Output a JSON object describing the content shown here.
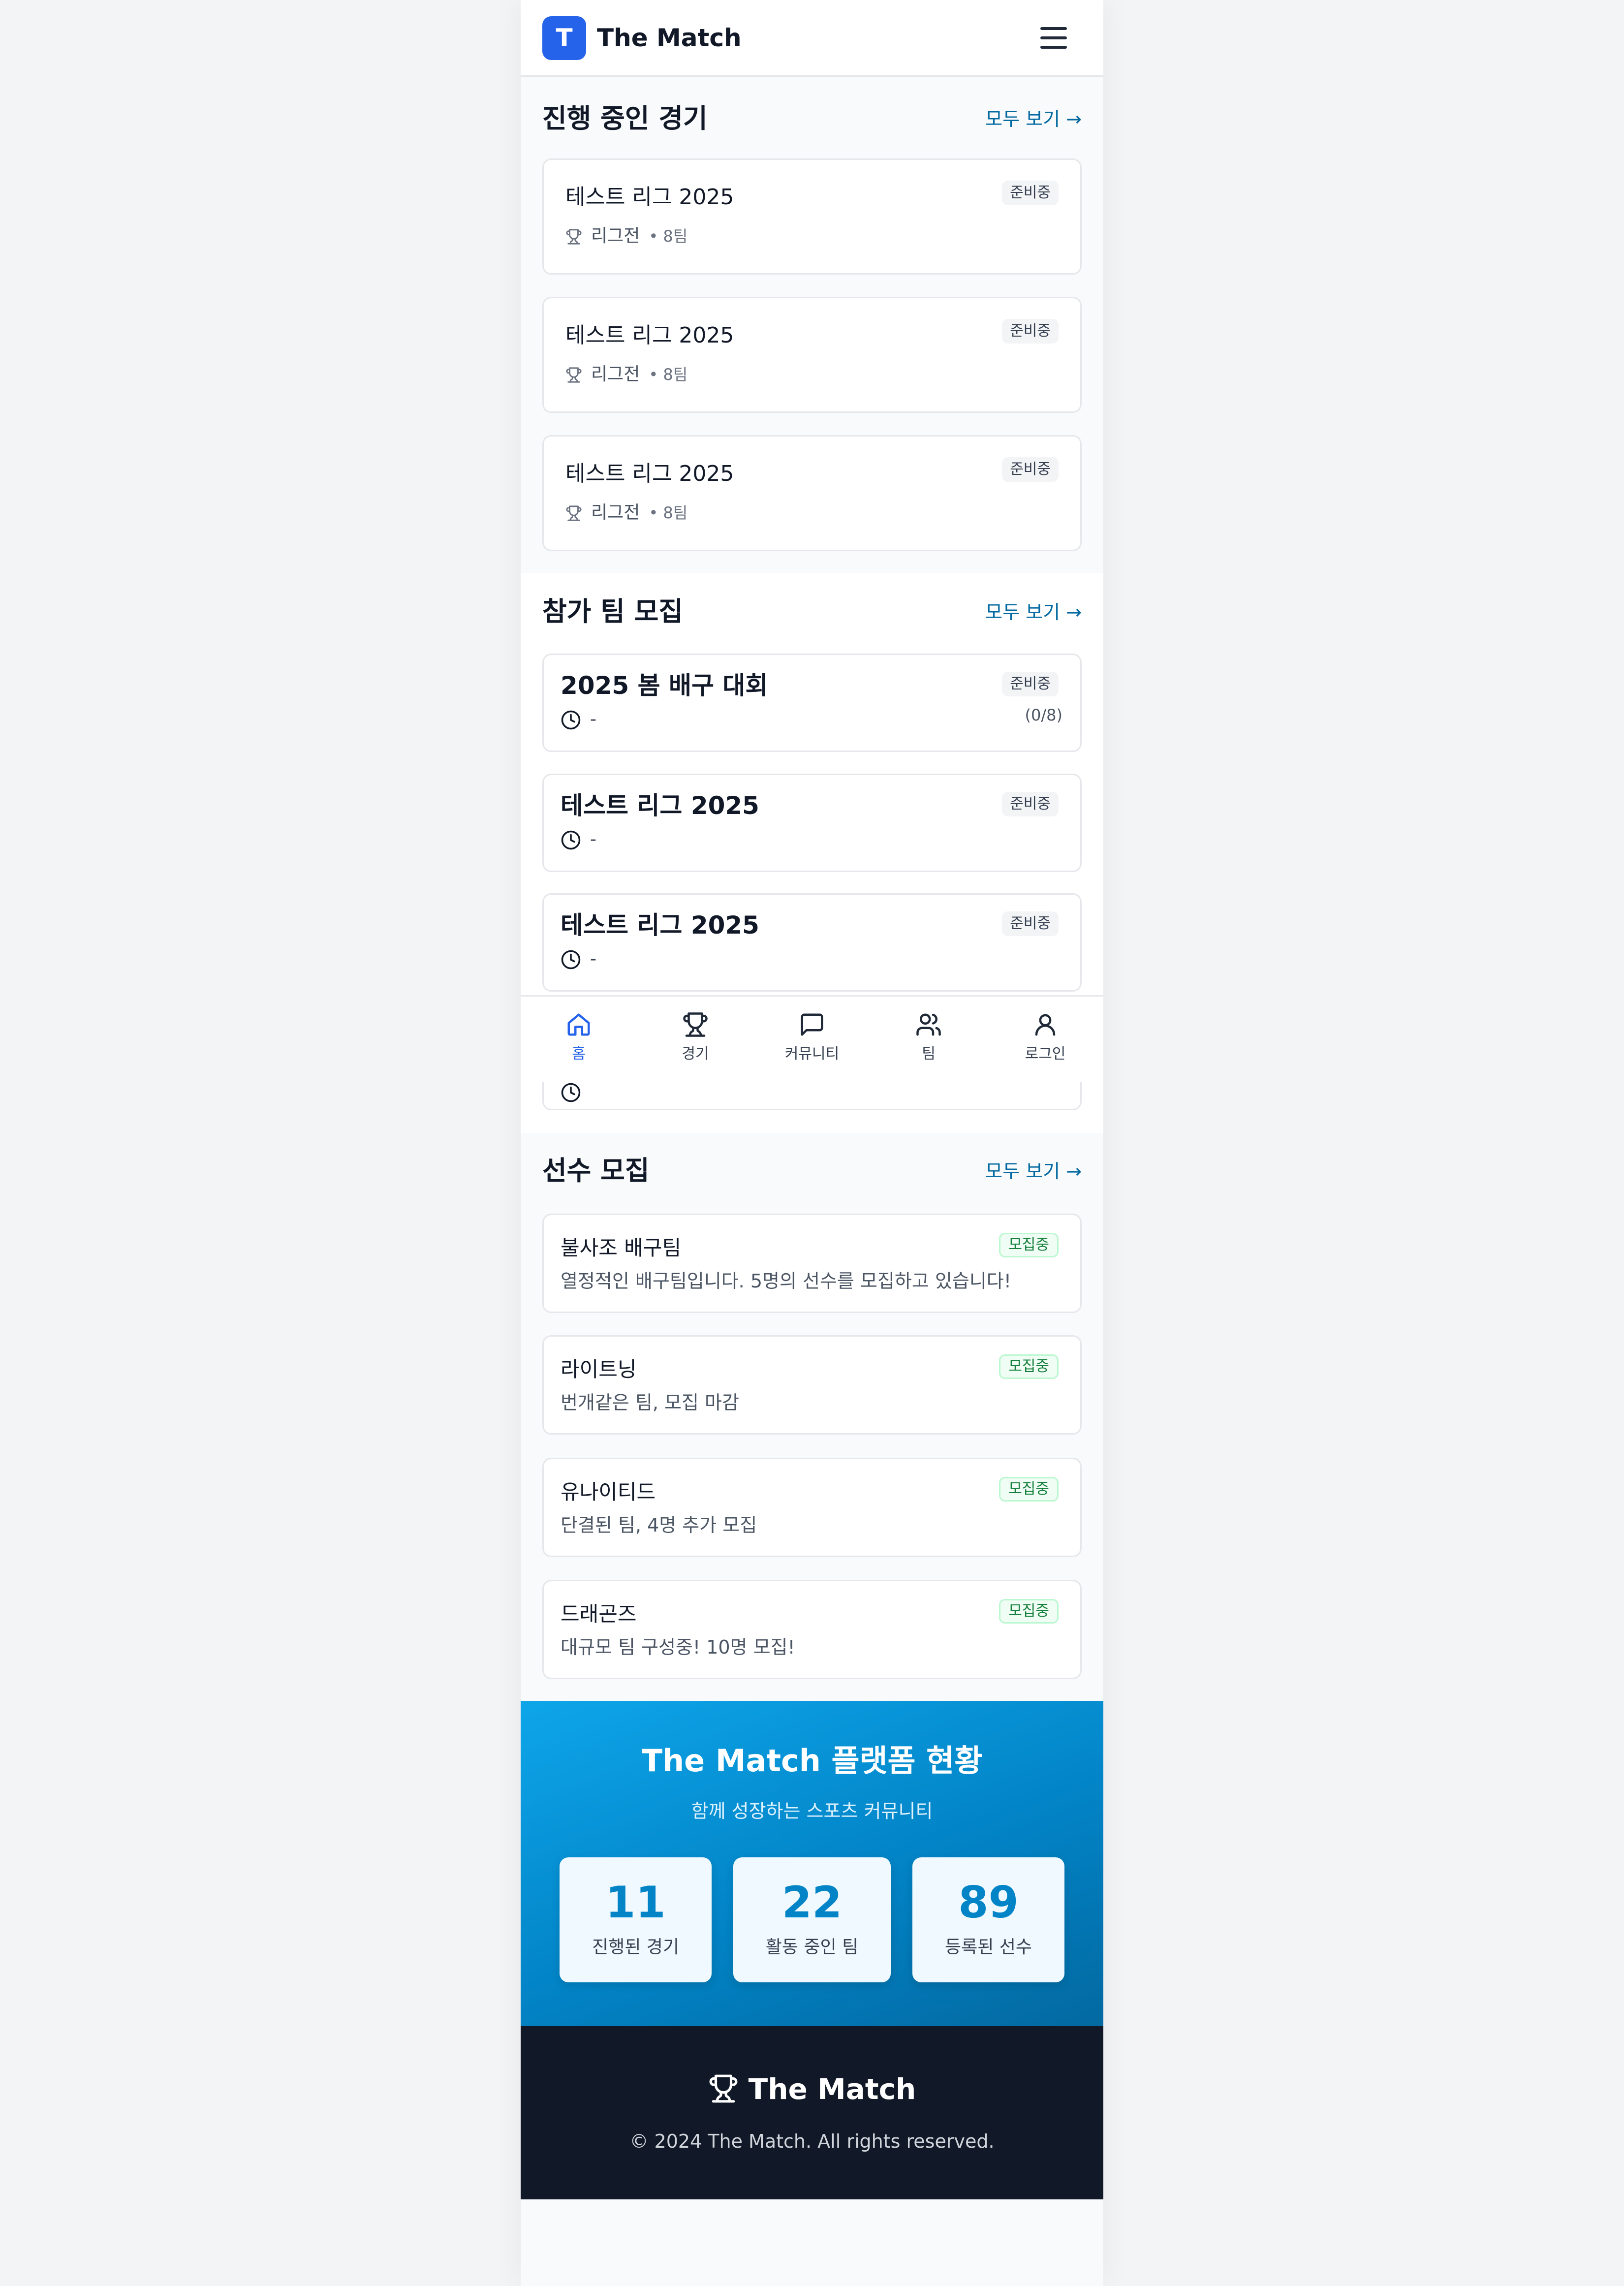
{
  "header": {
    "logo_letter": "T",
    "brand": "The Match",
    "menu_icon": "menu-icon"
  },
  "ongoing": {
    "title": "진행 중인 경기",
    "see_all": "모두 보기 →",
    "cards": [
      {
        "title": "테스트 리그 2025",
        "type": "리그전",
        "teams": "• 8팀",
        "status": "준비중"
      },
      {
        "title": "테스트 리그 2025",
        "type": "리그전",
        "teams": "• 8팀",
        "status": "준비중"
      },
      {
        "title": "테스트 리그 2025",
        "type": "리그전",
        "teams": "• 8팀",
        "status": "준비중"
      }
    ]
  },
  "recruit_teams": {
    "title": "참가 팀 모집",
    "see_all": "모두 보기 →",
    "cards": [
      {
        "title": "2025 봄 배구 대회",
        "time": "-",
        "status": "준비중",
        "count": "(0/8)"
      },
      {
        "title": "테스트 리그 2025",
        "time": "-",
        "status": "준비중"
      },
      {
        "title": "테스트 리그 2025",
        "time": "-",
        "status": "준비중"
      }
    ]
  },
  "bottom_nav": {
    "items": [
      {
        "label": "홈",
        "icon": "home-icon",
        "active": true
      },
      {
        "label": "경기",
        "icon": "trophy-icon"
      },
      {
        "label": "커뮤니티",
        "icon": "chat-icon"
      },
      {
        "label": "팀",
        "icon": "users-icon"
      },
      {
        "label": "로그인",
        "icon": "user-icon"
      }
    ]
  },
  "players": {
    "title": "선수 모집",
    "see_all": "모두 보기 →",
    "cards": [
      {
        "title": "불사조 배구팀",
        "desc": "열정적인 배구팀입니다. 5명의 선수를 모집하고 있습니다!",
        "status": "모집중"
      },
      {
        "title": "라이트닝",
        "desc": "번개같은 팀, 모집 마감",
        "status": "모집중"
      },
      {
        "title": "유나이티드",
        "desc": "단결된 팀, 4명 추가 모집",
        "status": "모집중"
      },
      {
        "title": "드래곤즈",
        "desc": "대규모 팀 구성중! 10명 모집!",
        "status": "모집중"
      }
    ]
  },
  "stats": {
    "title": "The Match 플랫폼 현황",
    "subtitle": "함께 성장하는 스포츠 커뮤니티",
    "items": [
      {
        "value": "11",
        "label": "진행된 경기"
      },
      {
        "value": "22",
        "label": "활동 중인 팀"
      },
      {
        "value": "89",
        "label": "등록된 선수"
      }
    ]
  },
  "footer": {
    "brand": "The Match",
    "copyright": "© 2024 The Match. All rights reserved."
  },
  "colors": {
    "primary": "#2563eb",
    "link": "#0369a1",
    "stats_gradient_start": "#0ea5e9",
    "stats_gradient_end": "#0369a1",
    "footer_bg": "#111827",
    "badge_green": "#15803d"
  }
}
